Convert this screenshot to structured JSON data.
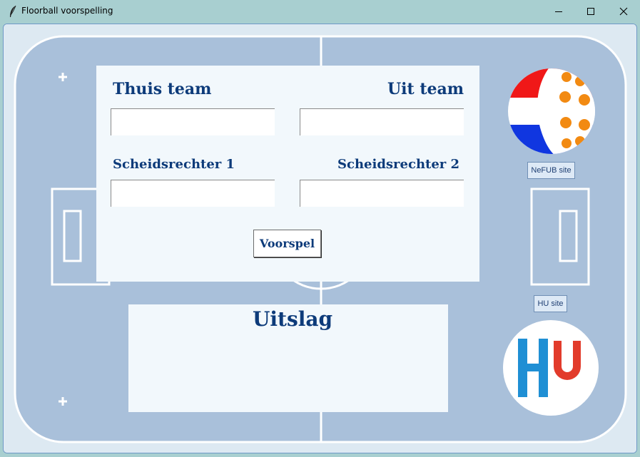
{
  "window": {
    "title": "Floorball voorspelling",
    "minimize_label": "—",
    "maximize_label": "☐",
    "close_label": "✕"
  },
  "form": {
    "home_team_label": "Thuis team",
    "away_team_label": "Uit team",
    "referee1_label": "Scheidsrechter 1",
    "referee2_label": "Scheidsrechter 2",
    "home_team_value": "",
    "away_team_value": "",
    "referee1_value": "",
    "referee2_value": "",
    "predict_button": "Voorspel"
  },
  "result": {
    "title": "Uitslag",
    "text": ""
  },
  "links": {
    "nefub_button": "NeFUB site",
    "hu_button": "HU site"
  },
  "colors": {
    "court": "#a9c0da",
    "panel": "#f2f8fc",
    "label_text": "#0d3b7a",
    "hu_blue": "#1f8fd4",
    "hu_red": "#e23b2b",
    "flag_red": "#f01818",
    "flag_blue": "#1036e0",
    "ball_holes": "#f28a12"
  },
  "icons": {
    "app_icon": "feather-icon",
    "nefub_logo": "floorball-flag-logo",
    "hu_logo": "hu-logo"
  }
}
